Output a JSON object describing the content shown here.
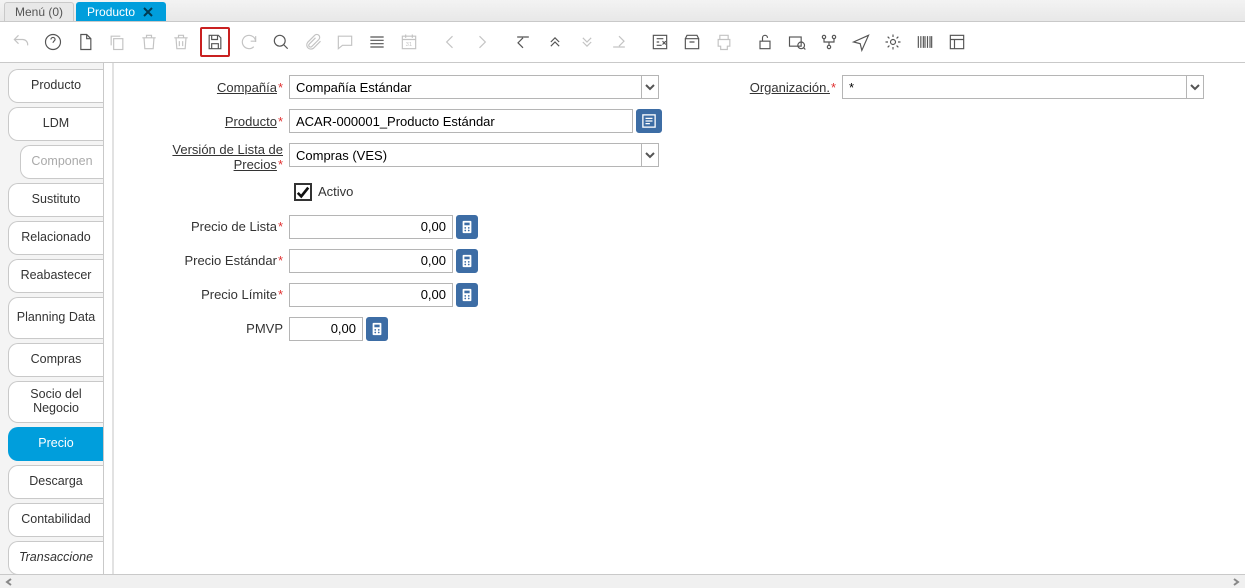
{
  "window_tabs": {
    "menu_label": "Menú (0)",
    "doc_label": "Producto"
  },
  "toolbar": {
    "undo": "undo",
    "help": "help",
    "new": "new",
    "copy": "copy",
    "delete": "delete",
    "delete_selection": "delete-selection",
    "save": "save",
    "refresh": "refresh",
    "search": "search",
    "attach": "attach",
    "chat": "chat",
    "grid": "grid-toggle",
    "calendar": "calendar",
    "first": "first",
    "prev": "previous",
    "next": "next",
    "last": "last",
    "parent_first": "parent-first",
    "parent_prev": "parent-prev",
    "parent_next": "parent-next",
    "parent_last": "parent-last",
    "report": "report",
    "archive": "archive",
    "print": "print",
    "lock": "lock",
    "zoom_across": "zoom-across",
    "workflow": "workflow",
    "request": "request",
    "process": "process",
    "product_info": "product-info",
    "customize": "customize"
  },
  "side_tabs": [
    {
      "key": "producto",
      "label": "Producto",
      "active": false
    },
    {
      "key": "ldm",
      "label": "LDM",
      "active": false
    },
    {
      "key": "componentes",
      "label": "Componen",
      "active": false,
      "indented": true
    },
    {
      "key": "sustituto",
      "label": "Sustituto",
      "active": false
    },
    {
      "key": "relacionado",
      "label": "Relacionado",
      "active": false
    },
    {
      "key": "reabastecer",
      "label": "Reabastecer",
      "active": false
    },
    {
      "key": "planning",
      "label": "Planning Data",
      "active": false,
      "tall": true
    },
    {
      "key": "compras",
      "label": "Compras",
      "active": false
    },
    {
      "key": "socio",
      "label": "Socio del Negocio",
      "active": false,
      "tall": true
    },
    {
      "key": "precio",
      "label": "Precio",
      "active": true
    },
    {
      "key": "descarga",
      "label": "Descarga",
      "active": false
    },
    {
      "key": "contabilidad",
      "label": "Contabilidad",
      "active": false
    },
    {
      "key": "transacciones",
      "label": "Transaccione",
      "active": false,
      "italic": true
    }
  ],
  "form": {
    "compania_label": "Compañía",
    "compania_value": "Compañía Estándar",
    "organizacion_label": "Organización.",
    "organizacion_value": "*",
    "producto_label": "Producto",
    "producto_value": "ACAR-000001_Producto Estándar",
    "version_label_line1": "Versión de Lista de",
    "version_label_line2": "Precios",
    "version_value": "Compras (VES)",
    "activo_label": "Activo",
    "activo_checked": true,
    "precio_lista_label": "Precio de Lista",
    "precio_lista_value": "0,00",
    "precio_estandar_label": "Precio Estándar",
    "precio_estandar_value": "0,00",
    "precio_limite_label": "Precio Límite",
    "precio_limite_value": "0,00",
    "pmvp_label": "PMVP",
    "pmvp_value": "0,00"
  }
}
